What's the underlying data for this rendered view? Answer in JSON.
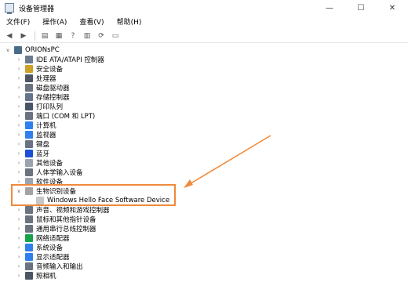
{
  "window": {
    "title": "设备管理器",
    "controls": {
      "minimize": "—",
      "maximize": "☐",
      "close": "✕"
    }
  },
  "menubar": {
    "items": [
      {
        "label": "文件(F)"
      },
      {
        "label": "操作(A)"
      },
      {
        "label": "查看(V)"
      },
      {
        "label": "帮助(H)"
      }
    ]
  },
  "toolbar": {
    "buttons": [
      {
        "icon": "back-arrow-icon"
      },
      {
        "icon": "forward-arrow-icon"
      },
      {
        "icon": "properties-icon"
      },
      {
        "icon": "grid-icon"
      },
      {
        "icon": "help-icon"
      },
      {
        "icon": "table-icon"
      },
      {
        "icon": "scan-hardware-icon"
      },
      {
        "icon": "monitor-icon"
      }
    ]
  },
  "tree": {
    "root": {
      "label": "ORIONsPC",
      "expander": "∨"
    },
    "categories": [
      {
        "label": "IDE ATA/ATAPI 控制器",
        "color": "#6b7b8c"
      },
      {
        "label": "安全设备",
        "color": "#c9a227"
      },
      {
        "label": "处理器",
        "color": "#4b5563"
      },
      {
        "label": "磁盘驱动器",
        "color": "#6b7280"
      },
      {
        "label": "存储控制器",
        "color": "#64748b"
      },
      {
        "label": "打印队列",
        "color": "#475569"
      },
      {
        "label": "端口 (COM 和 LPT)",
        "color": "#6b7280"
      },
      {
        "label": "计算机",
        "color": "#2f80ed"
      },
      {
        "label": "监视器",
        "color": "#2f80ed"
      },
      {
        "label": "键盘",
        "color": "#6b7280"
      },
      {
        "label": "蓝牙",
        "color": "#1d4ed8"
      },
      {
        "label": "其他设备",
        "color": "#9ca3af"
      },
      {
        "label": "人体学输入设备",
        "color": "#6b7280"
      },
      {
        "label": "软件设备",
        "color": "#9ca3af"
      },
      {
        "label": "生物识别设备",
        "color": "#a3a3a3",
        "expanded": true,
        "child": "Windows Hello Face Software Device"
      },
      {
        "label": "声音、视频和游戏控制器",
        "color": "#6b7280"
      },
      {
        "label": "鼠标和其他指针设备",
        "color": "#6b7280"
      },
      {
        "label": "通用串行总线控制器",
        "color": "#6b7280"
      },
      {
        "label": "网络适配器",
        "color": "#16a34a"
      },
      {
        "label": "系统设备",
        "color": "#2f80ed"
      },
      {
        "label": "显示适配器",
        "color": "#2f80ed"
      },
      {
        "label": "音频输入和输出",
        "color": "#6b7280"
      },
      {
        "label": "照相机",
        "color": "#4b5563"
      }
    ],
    "expander_collapsed": "›",
    "expander_expanded": "∨"
  },
  "annotation": {
    "color": "#f08a3c"
  }
}
